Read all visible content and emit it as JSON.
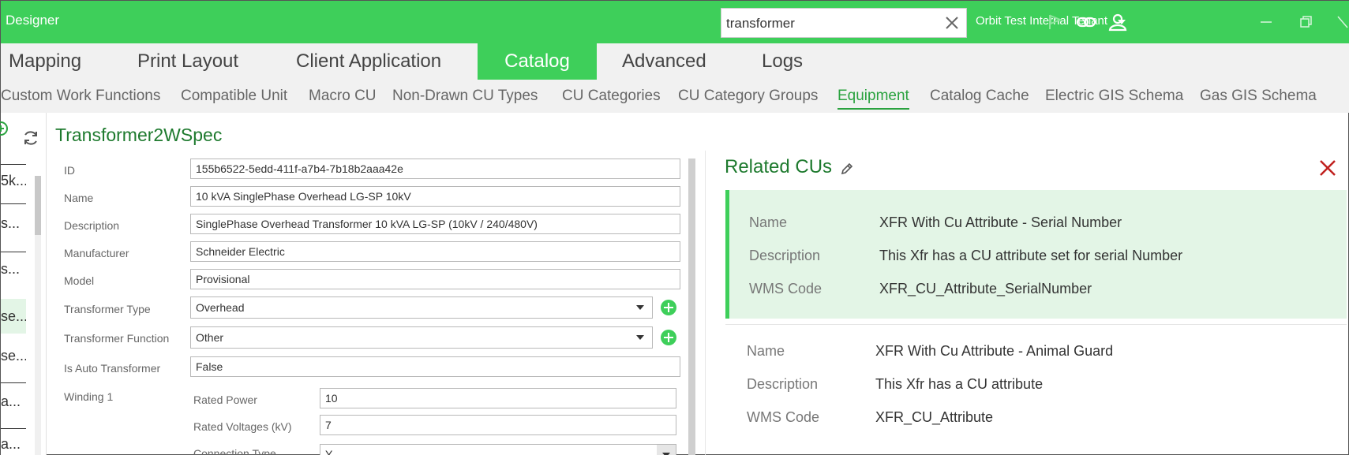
{
  "app": {
    "title": "Designer"
  },
  "search": {
    "value": "transformer"
  },
  "tenant": {
    "label": "Orbit Test Internal Tenant"
  },
  "main_tabs": [
    {
      "label": "Mapping"
    },
    {
      "label": "Print Layout"
    },
    {
      "label": "Client Application"
    },
    {
      "label": "Catalog"
    },
    {
      "label": "Advanced"
    },
    {
      "label": "Logs"
    }
  ],
  "sub_tabs": [
    {
      "label": "Custom Work Functions"
    },
    {
      "label": "Compatible Unit"
    },
    {
      "label": "Macro CU"
    },
    {
      "label": "Non-Drawn CU Types"
    },
    {
      "label": "CU Categories"
    },
    {
      "label": "CU Category Groups"
    },
    {
      "label": "Equipment"
    },
    {
      "label": "Catalog Cache"
    },
    {
      "label": "Electric GIS Schema"
    },
    {
      "label": "Gas GIS Schema"
    }
  ],
  "left_list": [
    {
      "label": "5k..."
    },
    {
      "label": "s..."
    },
    {
      "label": "s..."
    },
    {
      "label": "se..."
    },
    {
      "label": "se..."
    },
    {
      "label": "a..."
    },
    {
      "label": "a..."
    }
  ],
  "detail": {
    "title": "Transformer2WSpec",
    "fields": {
      "id": {
        "label": "ID",
        "value": "155b6522-5edd-411f-a7b4-7b18b2aaa42e"
      },
      "name": {
        "label": "Name",
        "value": "10 kVA SinglePhase Overhead LG-SP 10kV"
      },
      "description": {
        "label": "Description",
        "value": "SinglePhase Overhead Transformer 10 kVA LG-SP (10kV / 240/480V)"
      },
      "manufacturer": {
        "label": "Manufacturer",
        "value": "Schneider Electric"
      },
      "model": {
        "label": "Model",
        "value": "Provisional"
      },
      "transformer_type": {
        "label": "Transformer Type",
        "value": "Overhead"
      },
      "transformer_function": {
        "label": "Transformer Function",
        "value": "Other"
      },
      "is_auto": {
        "label": "Is Auto Transformer",
        "value": "False"
      }
    },
    "winding": {
      "label": "Winding 1",
      "rated_power": {
        "label": "Rated Power",
        "value": "10"
      },
      "rated_voltages": {
        "label": "Rated Voltages (kV)",
        "value": "7"
      },
      "connection_type": {
        "label": "Connection Type",
        "value": "Y"
      }
    }
  },
  "related": {
    "title": "Related CUs",
    "items": [
      {
        "name_label": "Name",
        "name": "XFR With Cu Attribute - Serial Number",
        "desc_label": "Description",
        "description": "This Xfr has a CU attribute set for serial Number",
        "wms_label": "WMS Code",
        "wms": "XFR_CU_Attribute_SerialNumber"
      },
      {
        "name_label": "Name",
        "name": "XFR With Cu Attribute - Animal Guard",
        "desc_label": "Description",
        "description": "This Xfr has a CU attribute",
        "wms_label": "WMS Code",
        "wms": "XFR_CU_Attribute"
      }
    ]
  },
  "colors": {
    "brand_green": "#3ecf5a",
    "title_green": "#1e7a2e",
    "selected_bg": "#e3f5e6",
    "close_red": "#c0201e"
  }
}
